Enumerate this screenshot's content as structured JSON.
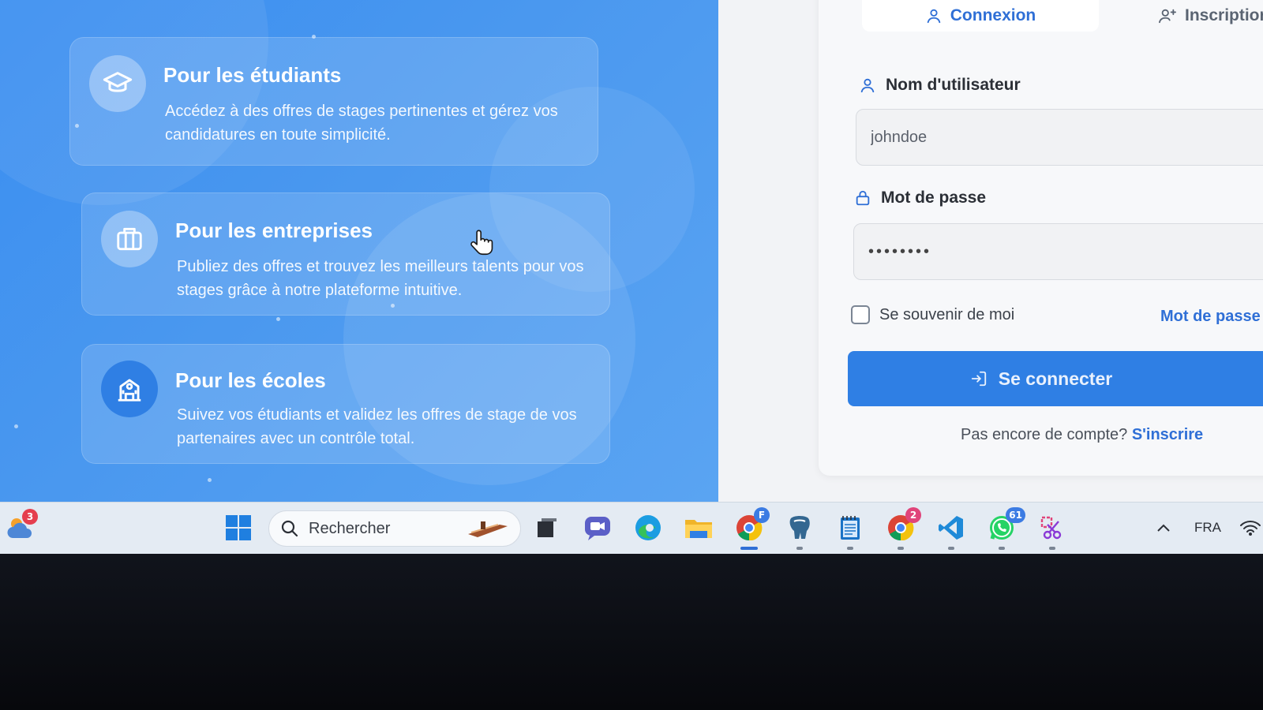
{
  "features": [
    {
      "icon": "graduation-cap-icon",
      "title": "Pour les étudiants",
      "description": "Accédez à des offres de stages pertinentes et gérez vos candidatures en toute simplicité."
    },
    {
      "icon": "briefcase-icon",
      "title": "Pour les entreprises",
      "description": "Publiez des offres et trouvez les meilleurs talents pour vos stages grâce à notre plateforme intuitive."
    },
    {
      "icon": "school-building-icon",
      "title": "Pour les écoles",
      "description": "Suivez vos étudiants et validez les offres de stage de vos partenaires avec un contrôle total."
    }
  ],
  "auth": {
    "tabs": {
      "login": "Connexion",
      "register": "Inscription"
    },
    "username": {
      "label": "Nom d'utilisateur",
      "value": "johndoe"
    },
    "password": {
      "label": "Mot de passe",
      "value": "••••••••"
    },
    "remember_label": "Se souvenir de moi",
    "forgot_label": "Mot de passe",
    "submit_label": "Se connecter",
    "no_account_text": "Pas encore de compte?",
    "signup_link": "S'inscrire"
  },
  "taskbar": {
    "weather_badge": "3",
    "search_placeholder": "Rechercher",
    "chrome_badge": "F",
    "chrome2_badge": "2",
    "whatsapp_badge": "61",
    "language": "FRA"
  },
  "colors": {
    "hero_blue": "#3a8ef0",
    "accent": "#2f7fe4",
    "link": "#2f6fd6"
  }
}
